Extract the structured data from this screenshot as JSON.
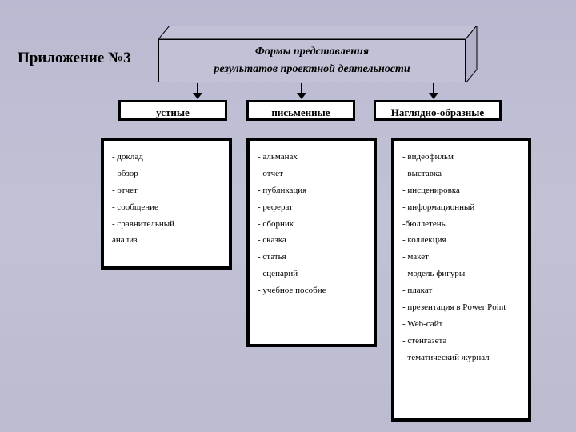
{
  "page_title": "Приложение №3",
  "topbox": {
    "line1": "Формы представления",
    "line2": "результатов проектной деятельности"
  },
  "categories": [
    {
      "label": "устные"
    },
    {
      "label": "письменные"
    },
    {
      "label": "Наглядно-образные"
    }
  ],
  "lists": [
    [
      "- доклад",
      "- обзор",
      "- отчет",
      "- сообщение",
      "- сравнительный",
      "анализ"
    ],
    [
      "- альманах",
      "- отчет",
      "- публикация",
      "- реферат",
      "- сборник",
      "- сказка",
      "- статья",
      "- сценарий",
      "- учебное пособие"
    ],
    [
      "- видеофильм",
      "- выставка",
      "- инсценировка",
      "- информационный",
      "-бюллетень",
      "- коллекция",
      "- макет",
      "- модель фигуры",
      "- плакат",
      "- презентация в Power Point",
      "- Web-сайт",
      "- стенгазета",
      "- тематический журнал"
    ]
  ]
}
